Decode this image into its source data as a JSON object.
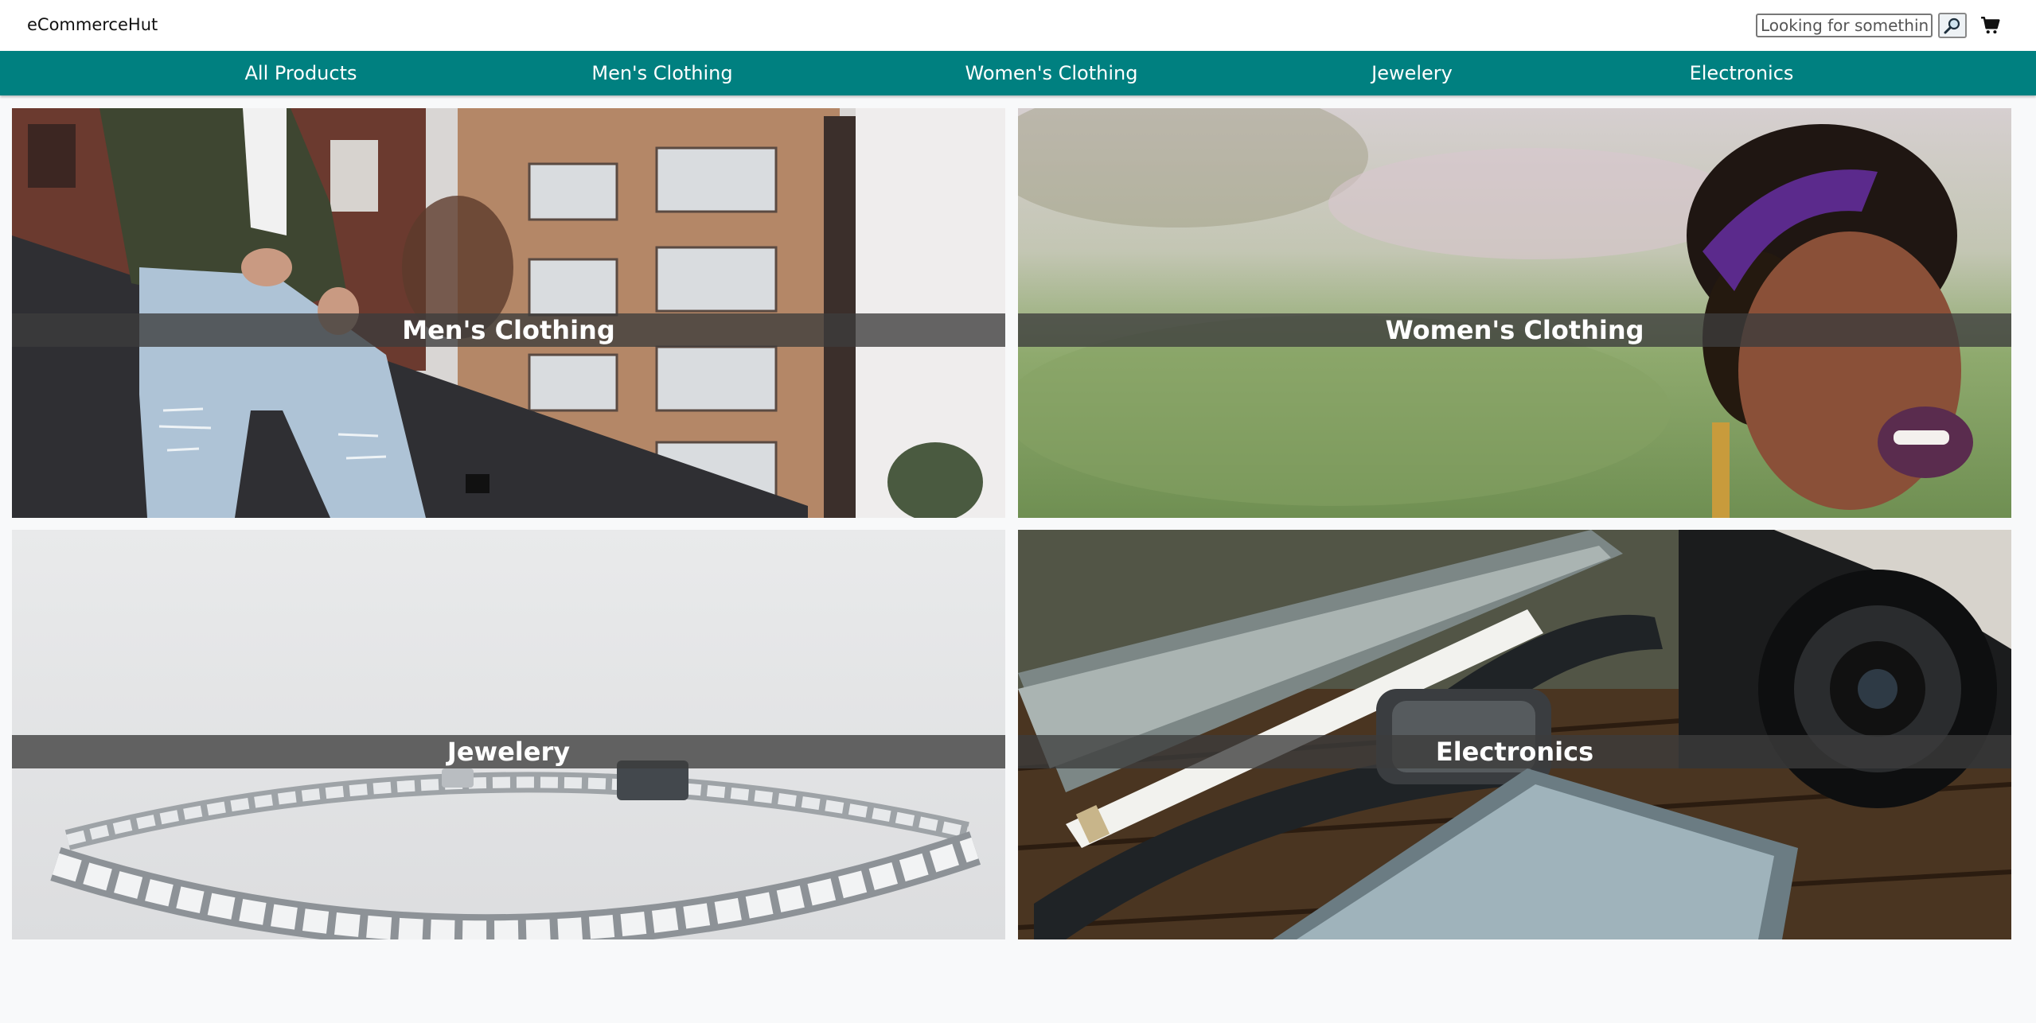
{
  "header": {
    "brand": "eCommerceHut",
    "search_placeholder": "Looking for something?",
    "search_icon": "magnifier-icon",
    "cart_icon": "shopping-cart-icon"
  },
  "nav": {
    "items": [
      {
        "label": "All Products"
      },
      {
        "label": "Men's Clothing"
      },
      {
        "label": "Women's Clothing"
      },
      {
        "label": "Jewelery"
      },
      {
        "label": "Electronics"
      }
    ]
  },
  "categories": [
    {
      "label": "Men's Clothing"
    },
    {
      "label": "Women's Clothing"
    },
    {
      "label": "Jewelery"
    },
    {
      "label": "Electronics"
    }
  ],
  "colors": {
    "nav_background": "#008080",
    "page_background": "#f8f9fa",
    "label_bar": "#3c3c3c"
  }
}
